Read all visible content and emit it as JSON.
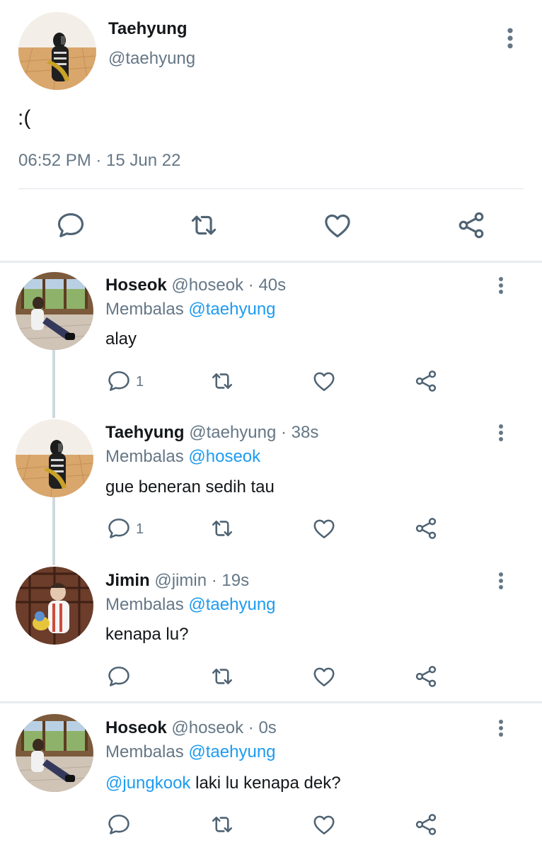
{
  "main_tweet": {
    "author_name": "Taehyung",
    "author_handle": "@taehyung",
    "text": ":(",
    "timestamp": "06:52 PM · 15 Jun 22"
  },
  "replies": [
    {
      "name": "Hoseok",
      "meta": "@hoseok · 40s",
      "replying_prefix": "Membalas",
      "replying_to": "@taehyung",
      "mention": "",
      "text": "alay",
      "reply_count": "1"
    },
    {
      "name": "Taehyung",
      "meta": "@taehyung · 38s",
      "replying_prefix": "Membalas",
      "replying_to": "@hoseok",
      "mention": "",
      "text": "gue beneran sedih tau",
      "reply_count": "1"
    },
    {
      "name": "Jimin",
      "meta": "@jimin · 19s",
      "replying_prefix": "Membalas",
      "replying_to": "@taehyung",
      "mention": "",
      "text": "kenapa lu?",
      "reply_count": ""
    },
    {
      "name": "Hoseok",
      "meta": "@hoseok · 0s",
      "replying_prefix": "Membalas",
      "replying_to": "@taehyung",
      "mention": "@jungkook",
      "text": " laki lu kenapa dek?",
      "reply_count": ""
    }
  ],
  "icons": {
    "reply": "reply-icon",
    "retweet": "retweet-icon",
    "like": "like-icon",
    "share": "share-icon",
    "more": "more-icon"
  },
  "colors": {
    "text": "#14171a",
    "secondary": "#657786",
    "accent": "#1d9bf0",
    "divider": "#e6ecf0"
  }
}
